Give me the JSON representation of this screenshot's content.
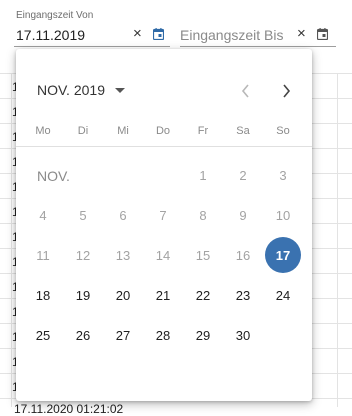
{
  "filters": {
    "from": {
      "label": "Eingangszeit Von",
      "value": "17.11.2019",
      "clear_icon": "×",
      "icon": "calendar-icon"
    },
    "to": {
      "placeholder": "Eingangszeit Bis",
      "clear_icon": "×",
      "icon": "calendar-icon"
    }
  },
  "table": {
    "row_prefix": "1",
    "partial_row": "17.11.2020 01:21:02"
  },
  "calendar": {
    "period_label": "NOV. 2019",
    "prev_icon": "chevron-left-icon",
    "next_icon": "chevron-right-icon",
    "weekdays": [
      "Mo",
      "Di",
      "Mi",
      "Do",
      "Fr",
      "Sa",
      "So"
    ],
    "month_label": "NOV.",
    "selected_day": "17",
    "weeks": [
      [
        "",
        "",
        "",
        "",
        "1",
        "2",
        "3"
      ],
      [
        "4",
        "5",
        "6",
        "7",
        "8",
        "9",
        "10"
      ],
      [
        "11",
        "12",
        "13",
        "14",
        "15",
        "16",
        "17"
      ],
      [
        "18",
        "19",
        "20",
        "21",
        "22",
        "23",
        "24"
      ],
      [
        "25",
        "26",
        "27",
        "28",
        "29",
        "30",
        ""
      ]
    ],
    "colors": {
      "selected": "#3a72b0",
      "disabled": "#a3a3a3"
    }
  }
}
